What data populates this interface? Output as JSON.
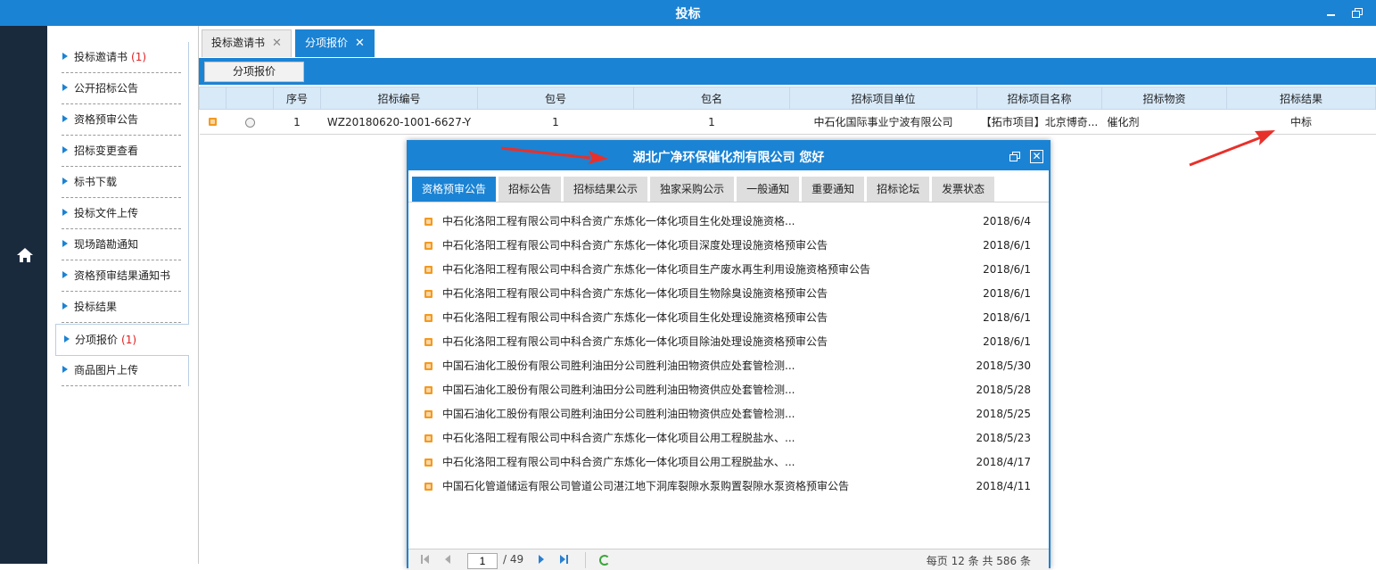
{
  "window": {
    "title": "投标"
  },
  "sidebar": {
    "items": [
      {
        "label": "投标邀请书",
        "count": "(1)"
      },
      {
        "label": "公开招标公告",
        "count": ""
      },
      {
        "label": "资格预审公告",
        "count": ""
      },
      {
        "label": "招标变更查看",
        "count": ""
      },
      {
        "label": "标书下载",
        "count": ""
      },
      {
        "label": "投标文件上传",
        "count": ""
      },
      {
        "label": "现场踏勘通知",
        "count": ""
      },
      {
        "label": "资格预审结果通知书",
        "count": ""
      },
      {
        "label": "投标结果",
        "count": ""
      },
      {
        "label": "分项报价",
        "count": "(1)"
      },
      {
        "label": "商品图片上传",
        "count": ""
      }
    ]
  },
  "tabs": [
    {
      "label": "投标邀请书",
      "close": "✕"
    },
    {
      "label": "分项报价",
      "close": "✕"
    }
  ],
  "toolbar": {
    "button_label": "分项报价"
  },
  "table": {
    "columns": [
      "",
      "",
      "序号",
      "招标编号",
      "包号",
      "包名",
      "招标项目单位",
      "招标项目名称",
      "招标物资",
      "招标结果"
    ],
    "rows": [
      {
        "seq": "1",
        "code": "WZ20180620-1001-6627-Y",
        "pkg_no": "1",
        "pkg_name": "1",
        "unit": "中石化国际事业宁波有限公司",
        "project": "【拓市项目】北京博奇...",
        "material": "催化剂",
        "result": "中标"
      }
    ]
  },
  "dialog": {
    "title": "湖北广净环保催化剂有限公司 您好",
    "close": "✕",
    "tabs": [
      "资格预审公告",
      "招标公告",
      "招标结果公示",
      "独家采购公示",
      "一般通知",
      "重要通知",
      "招标论坛",
      "发票状态"
    ],
    "notices": [
      {
        "text": "中石化洛阳工程有限公司中科合资广东炼化一体化项目生化处理设施资格...",
        "date": "2018/6/4"
      },
      {
        "text": "中石化洛阳工程有限公司中科合资广东炼化一体化项目深度处理设施资格预审公告",
        "date": "2018/6/1"
      },
      {
        "text": "中石化洛阳工程有限公司中科合资广东炼化一体化项目生产废水再生利用设施资格预审公告",
        "date": "2018/6/1"
      },
      {
        "text": "中石化洛阳工程有限公司中科合资广东炼化一体化项目生物除臭设施资格预审公告",
        "date": "2018/6/1"
      },
      {
        "text": "中石化洛阳工程有限公司中科合资广东炼化一体化项目生化处理设施资格预审公告",
        "date": "2018/6/1"
      },
      {
        "text": "中石化洛阳工程有限公司中科合资广东炼化一体化项目除油处理设施资格预审公告",
        "date": "2018/6/1"
      },
      {
        "text": "中国石油化工股份有限公司胜利油田分公司胜利油田物资供应处套管检测...",
        "date": "2018/5/30"
      },
      {
        "text": "中国石油化工股份有限公司胜利油田分公司胜利油田物资供应处套管检测...",
        "date": "2018/5/28"
      },
      {
        "text": "中国石油化工股份有限公司胜利油田分公司胜利油田物资供应处套管检测...",
        "date": "2018/5/25"
      },
      {
        "text": "中石化洛阳工程有限公司中科合资广东炼化一体化项目公用工程脱盐水、...",
        "date": "2018/5/23"
      },
      {
        "text": "中石化洛阳工程有限公司中科合资广东炼化一体化项目公用工程脱盐水、...",
        "date": "2018/4/17"
      },
      {
        "text": "中国石化管道储运有限公司管道公司湛江地下洞库裂隙水泵购置裂隙水泵资格预审公告",
        "date": "2018/4/11"
      }
    ],
    "pager": {
      "page": "1",
      "total": "/ 49",
      "info": "每页 12 条 共 586 条"
    }
  },
  "colors": {
    "accent": "#1b83d4",
    "sidebar_dark": "#1a2a3d",
    "annotation_red": "#e8302a"
  }
}
